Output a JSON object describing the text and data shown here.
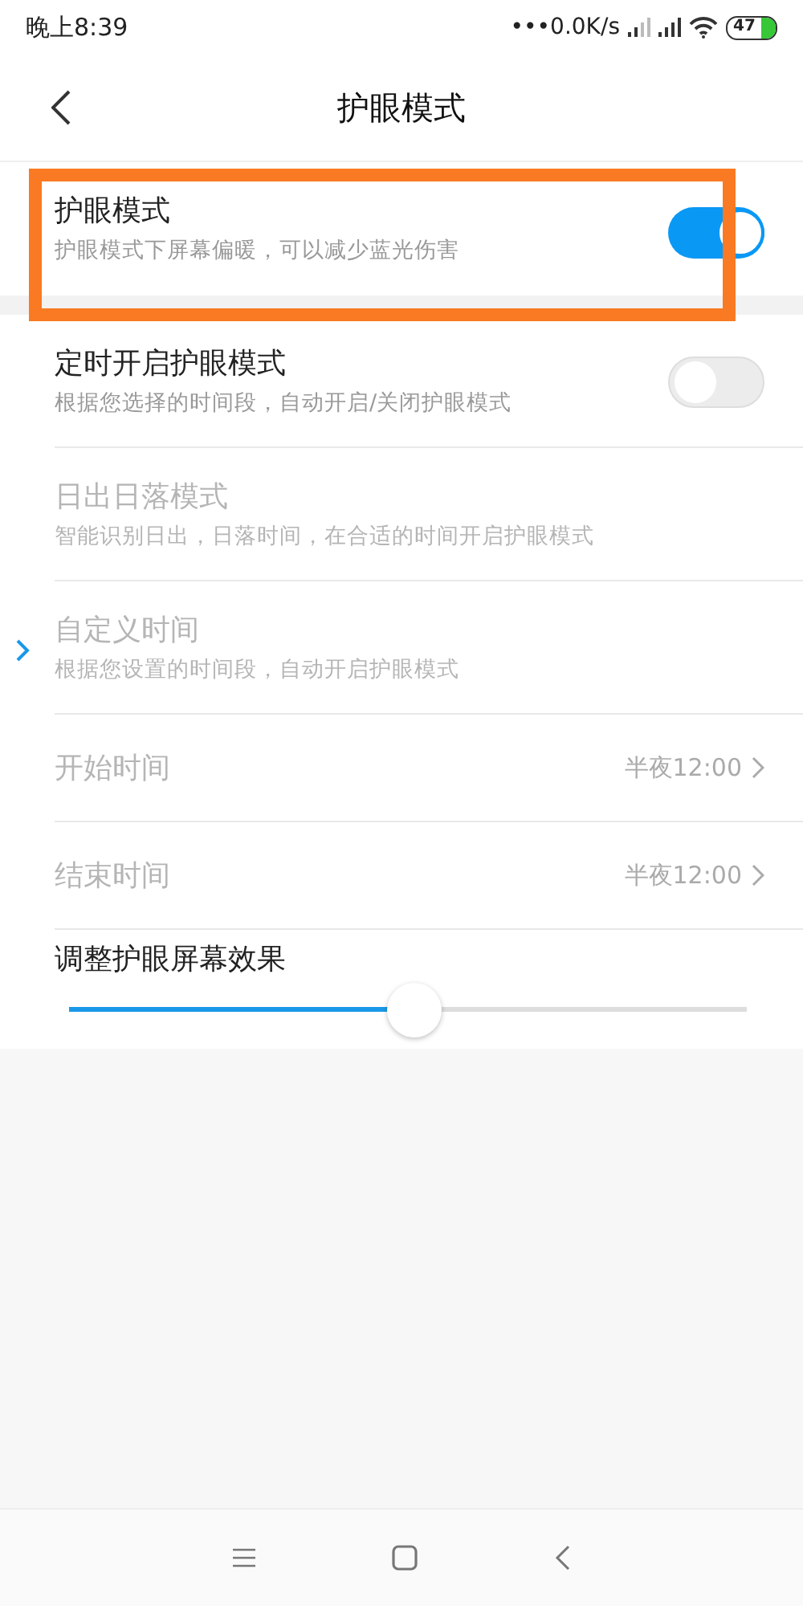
{
  "status_bar": {
    "time": "晚上8:39",
    "net_speed": "•••0.0K/s",
    "battery": "47"
  },
  "header": {
    "title": "护眼模式"
  },
  "eye_mode": {
    "title": "护眼模式",
    "subtitle": "护眼模式下屏幕偏暖，可以减少蓝光伤害",
    "on": true,
    "highlighted": true
  },
  "settings": [
    {
      "kind": "toggle",
      "title": "定时开启护眼模式",
      "subtitle": "根据您选择的时间段，自动开启/关闭护眼模式",
      "on": false,
      "disabled": false
    },
    {
      "kind": "option",
      "title": "日出日落模式",
      "subtitle": "智能识别日出，日落时间，在合适的时间开启护眼模式",
      "selected": false,
      "disabled": true
    },
    {
      "kind": "option",
      "title": "自定义时间",
      "subtitle": "根据您设置的时间段，自动开启护眼模式",
      "selected": true,
      "disabled": true
    },
    {
      "kind": "time",
      "title": "开始时间",
      "value": "半夜12:00",
      "disabled": true
    },
    {
      "kind": "time",
      "title": "结束时间",
      "value": "半夜12:00",
      "disabled": true
    },
    {
      "kind": "slider",
      "title": "调整护眼屏幕效果",
      "level": 0.51,
      "disabled": false
    }
  ]
}
